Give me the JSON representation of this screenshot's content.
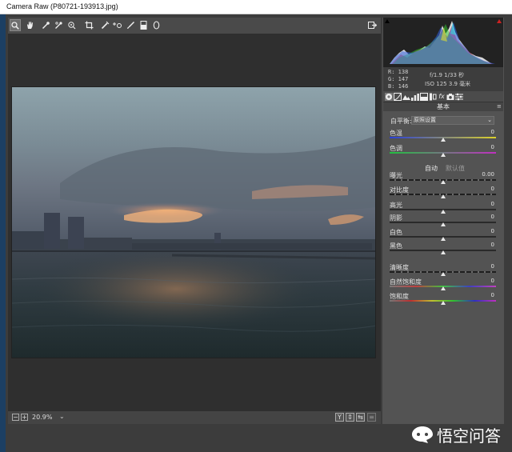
{
  "window": {
    "title": "Camera Raw (P80721-193913.jpg)"
  },
  "toolbar": {
    "tools": [
      {
        "name": "zoom-tool",
        "glyph": "🔍",
        "active": true
      },
      {
        "name": "hand-tool",
        "glyph": "✋"
      },
      {
        "name": "white-balance-tool",
        "glyph": "✎"
      },
      {
        "name": "color-sampler-tool",
        "glyph": "✎"
      },
      {
        "name": "targeted-adjustment-tool",
        "glyph": "◎"
      },
      {
        "name": "crop-tool",
        "glyph": "⌗"
      },
      {
        "name": "spot-removal-tool",
        "glyph": "✑"
      },
      {
        "name": "red-eye-tool",
        "glyph": "⊕"
      },
      {
        "name": "adjustment-brush-tool",
        "glyph": "✐"
      },
      {
        "name": "graduated-filter-tool",
        "glyph": "▮"
      },
      {
        "name": "radial-filter-tool",
        "glyph": "○"
      }
    ],
    "open_preferences_glyph": "⇱"
  },
  "histogram": {
    "shadow_clip_color": "#000000",
    "highlight_clip_color": "#cc2222"
  },
  "readout": {
    "r": "R:  138",
    "g": "G:  147",
    "b": "B:  146",
    "aperture_shutter": "f/1.9   1/33 秒",
    "iso_focal": "ISO 125   3.9 毫米"
  },
  "panel": {
    "title": "基本",
    "white_balance_label": "白平衡:",
    "white_balance_value": "原照设置",
    "auto_label": "自动",
    "default_label": "默认值",
    "sliders": [
      {
        "label": "色温",
        "value": "0",
        "pos": 0.5,
        "track": "temp"
      },
      {
        "label": "色调",
        "value": "0",
        "pos": 0.5,
        "track": "tint"
      },
      {
        "label": "曝光",
        "value": "0.00",
        "pos": 0.5,
        "track": "dashed"
      },
      {
        "label": "对比度",
        "value": "0",
        "pos": 0.5,
        "track": "dashed"
      },
      {
        "label": "高光",
        "value": "0",
        "pos": 0.5,
        "track": "plain"
      },
      {
        "label": "阴影",
        "value": "0",
        "pos": 0.5,
        "track": "plain"
      },
      {
        "label": "白色",
        "value": "0",
        "pos": 0.5,
        "track": "plain"
      },
      {
        "label": "黑色",
        "value": "0",
        "pos": 0.5,
        "track": "plain"
      },
      {
        "label": "清晰度",
        "value": "0",
        "pos": 0.5,
        "track": "dashed"
      },
      {
        "label": "自然饱和度",
        "value": "0",
        "pos": 0.5,
        "track": "vib"
      },
      {
        "label": "饱和度",
        "value": "0",
        "pos": 0.5,
        "track": "sat"
      }
    ]
  },
  "bottombar": {
    "zoom_out_glyph": "−",
    "zoom_in_glyph": "+",
    "zoom_value": "20.9%",
    "zoom_dropdown_glyph": "⌄",
    "view_buttons": [
      "Y",
      "⇕",
      "⇆",
      "≡"
    ]
  },
  "watermark": {
    "text": "悟空问答"
  }
}
